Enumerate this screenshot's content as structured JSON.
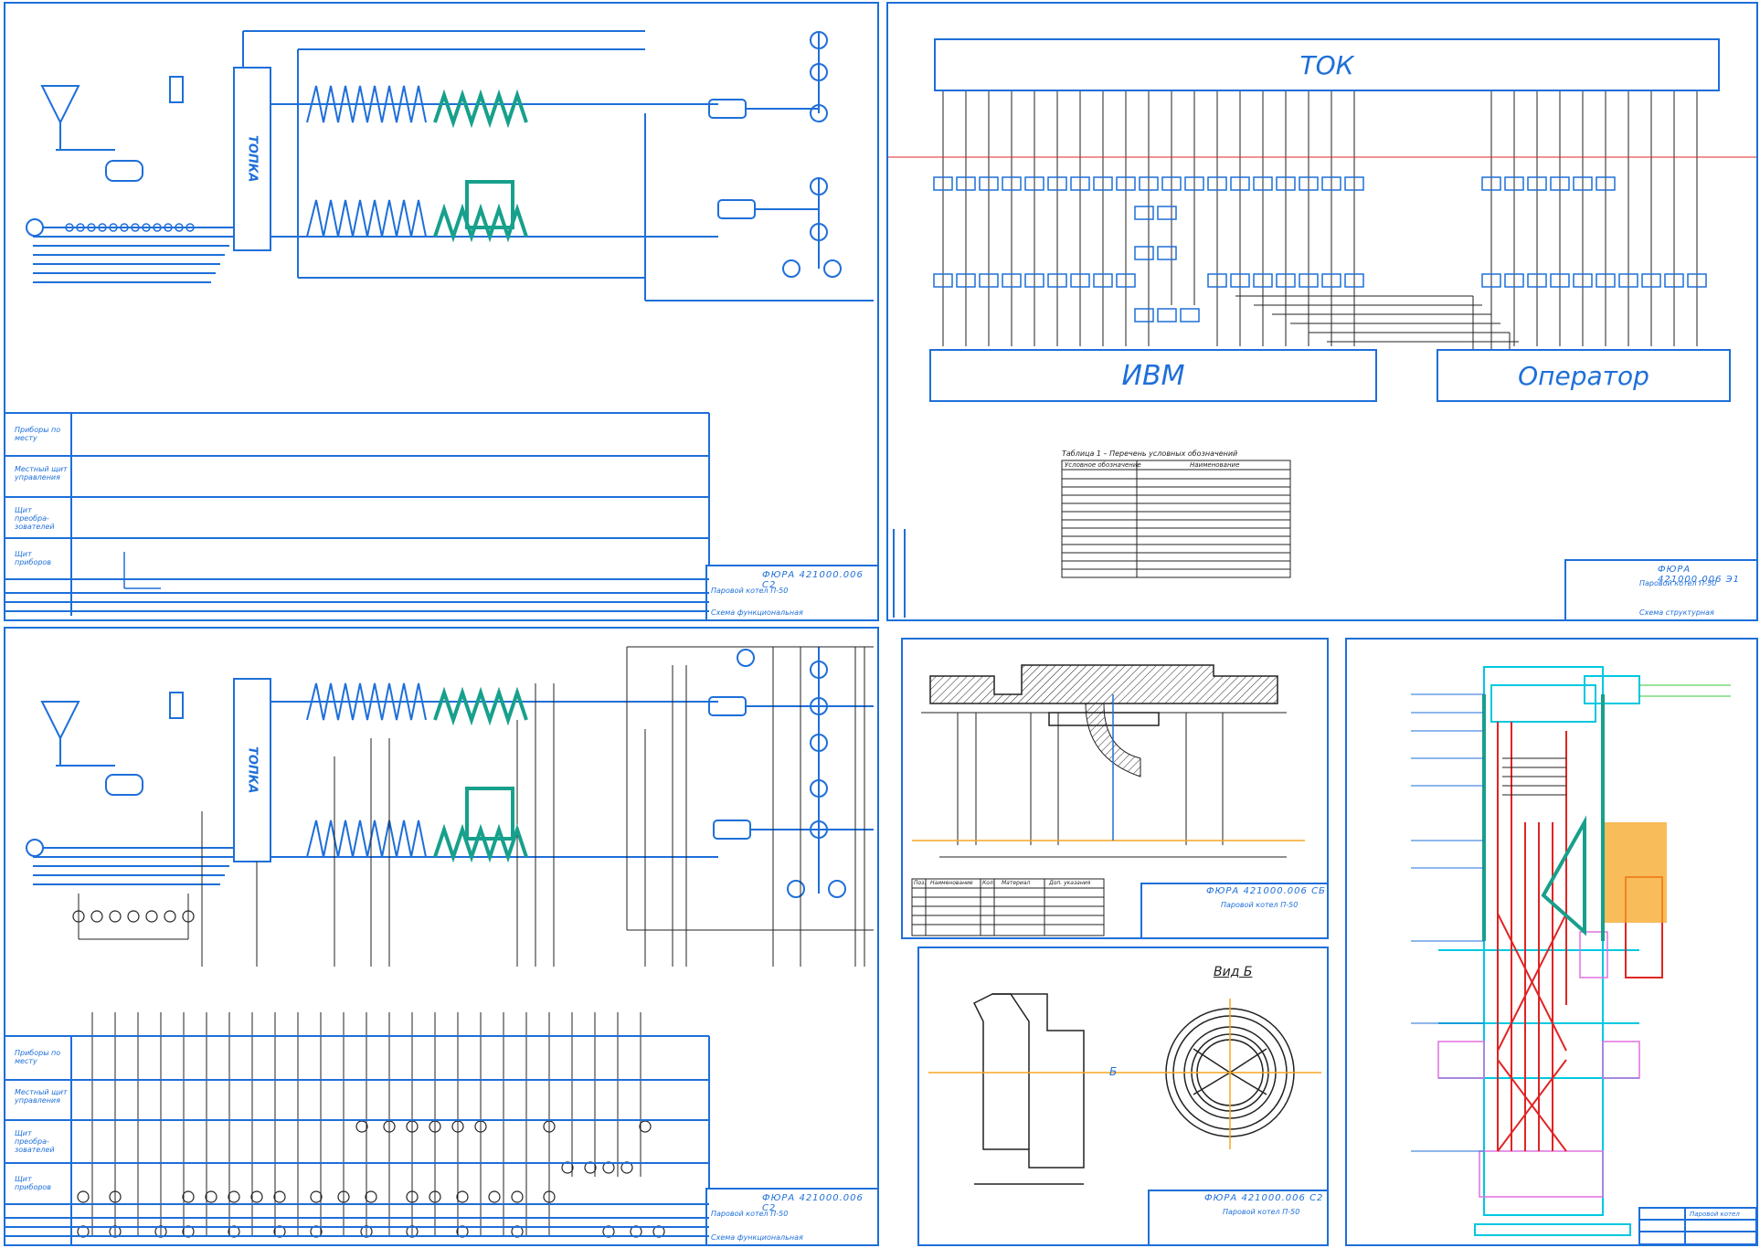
{
  "colors": {
    "line": "#1e6fd9",
    "teal": "#17a08c",
    "dark": "#222222",
    "red": "#e02424",
    "cyan": "#00c8e0",
    "orange": "#f5a623",
    "magenta": "#e070e0",
    "green": "#39c639"
  },
  "schema_top": {
    "furnace_label": "ТОПКА",
    "row_labels": [
      "Приборы по месту",
      "Местный щит управления",
      "Щит преобра-зователей",
      "Щит приборов"
    ],
    "stamp_code": "ФЮРА 421000.006 С2",
    "stamp_title": "Паровой котел П-50",
    "stamp_sub": "Схема функциональная"
  },
  "schema_bottom": {
    "furnace_label": "ТОПКА",
    "row_labels": [
      "Приборы по месту",
      "Местный щит управления",
      "Щит преобра-зователей",
      "Щит приборов"
    ],
    "stamp_code": "ФЮРА 421000.006 С2",
    "stamp_title": "Паровой котел П-50",
    "stamp_sub": "Схема функциональная"
  },
  "structure": {
    "top_block": "ТОК",
    "left_block": "ИВМ",
    "right_block": "Оператор",
    "table_caption": "Таблица 1 – Перечень условных обозначений",
    "table_headers": [
      "Условное обозначение",
      "Наименование"
    ],
    "stamp_code": "ФЮРА 421000.006 Э1",
    "stamp_title": "Паровой котел П-50",
    "stamp_sub": "Схема структурная"
  },
  "detail_top": {
    "stamp_code": "ФЮРА 421000.006 СБ",
    "stamp_title": "Паровой котел П-50",
    "parts_headers": [
      "Поз.",
      "Наименование",
      "Кол.",
      "Материал",
      "Доп. указания"
    ]
  },
  "detail_bottom": {
    "view_label": "Вид Б",
    "section_mark": "Б",
    "stamp_code": "ФЮРА 421000.006 С2",
    "stamp_title": "Паровой котел П-50"
  },
  "boiler": {
    "stamp_title": "Паровой котел"
  }
}
